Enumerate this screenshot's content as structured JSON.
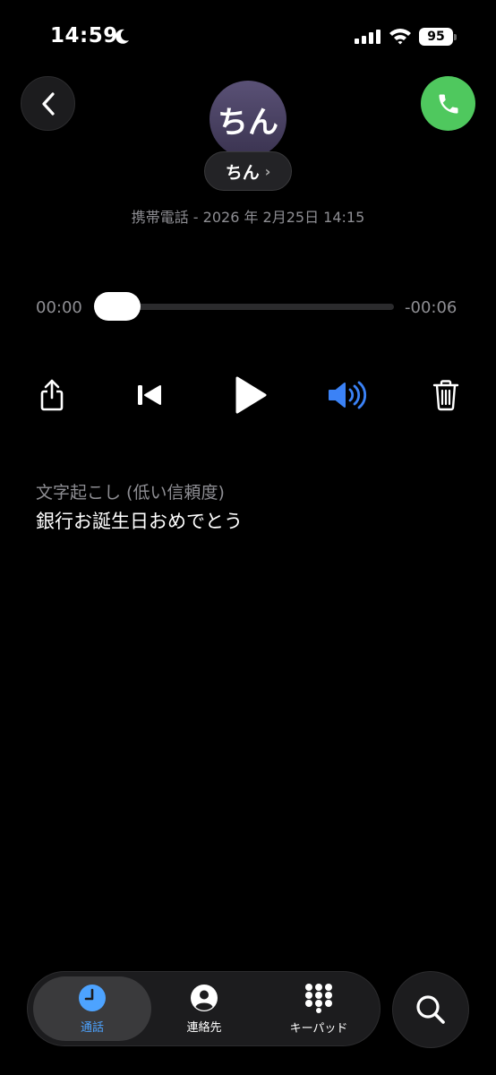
{
  "status_bar": {
    "time": "14:59",
    "battery": "95"
  },
  "contact": {
    "avatar_text": "ちん",
    "name": "ちん"
  },
  "voicemail": {
    "meta": "携帯電話 - 2026 年 2月25日 14:15",
    "elapsed": "00:00",
    "remaining": "-00:06",
    "progress": 0
  },
  "transcript": {
    "label": "文字起こし (低い信頼度)",
    "text": "銀行お誕生日おめでとう"
  },
  "tabs": [
    {
      "label": "通話",
      "icon": "clock-icon",
      "active": true
    },
    {
      "label": "連絡先",
      "icon": "person-icon",
      "active": false
    },
    {
      "label": "キーパッド",
      "icon": "keypad-icon",
      "active": false
    }
  ],
  "colors": {
    "accent": "#4da3ff",
    "call_green": "#4fc85e",
    "speaker_blue": "#3b82f6"
  }
}
